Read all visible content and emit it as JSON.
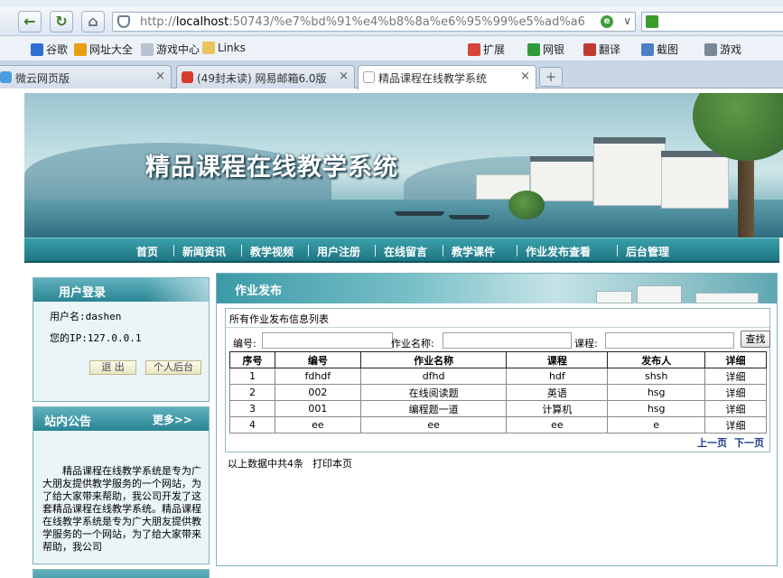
{
  "browser": {
    "url_prefix": "http://",
    "url_host": "localhost",
    "url_rest": ":50743/%e7%bd%91%e4%b8%8a%e6%95%99%e5%ad%a6",
    "bookmarks": [
      {
        "label": "谷歌",
        "icon": "google-icon",
        "color": "#2f6fd1"
      },
      {
        "label": "网址大全",
        "icon": "globe-icon",
        "color": "#e8a012"
      },
      {
        "label": "游戏中心",
        "icon": "page-icon",
        "color": "#b9c2cf"
      },
      {
        "label": "Links",
        "icon": "folder-icon",
        "color": "#e9c45a"
      },
      {
        "label": "扩展",
        "icon": "apps-icon",
        "color": "#d8453a"
      },
      {
        "label": "网银",
        "icon": "bank-icon",
        "color": "#2f9b3a"
      },
      {
        "label": "翻译",
        "icon": "translate-icon",
        "color": "#c03a2f"
      },
      {
        "label": "截图",
        "icon": "scissors-icon",
        "color": "#4c7fc6"
      },
      {
        "label": "游戏",
        "icon": "gamepad-icon",
        "color": "#7a8796"
      }
    ],
    "tabs": [
      {
        "label": "微云网页版",
        "color": "#4a9ee0"
      },
      {
        "label": "(49封未读) 网易邮箱6.0版",
        "color": "#d83a2b"
      },
      {
        "label": "精品课程在线教学系统",
        "color": "#cfd6df"
      }
    ]
  },
  "site": {
    "title": "精品课程在线教学系统",
    "nav": [
      "首页",
      "新闻资讯",
      "教学视频",
      "用户注册",
      "在线留言",
      "教学课件",
      "作业发布查看",
      "后台管理"
    ]
  },
  "login_box": {
    "heading": "用户登录",
    "username_line": "用户名:dashen",
    "ip_line": "您的IP:127.0.0.1",
    "logout_button": "退 出",
    "personal_button": "个人后台"
  },
  "notice_box": {
    "heading": "站内公告",
    "more": "更多>>",
    "text": "精品课程在线教学系统是专为广大朋友提供教学服务的一个网站，为了给大家带来帮助，我公司开发了这套精品课程在线教学系统。精品课程在线教学系统是专为广大朋友提供教学服务的一个网站，为了给大家带来帮助，我公司"
  },
  "content": {
    "heading": "作业发布",
    "list_title": "所有作业发布信息列表",
    "search": {
      "label_code": "编号:",
      "label_name": "作业名称:",
      "label_course": "课程:",
      "button": "查找",
      "value_code": "",
      "value_name": "",
      "value_course": ""
    },
    "table": {
      "headers": [
        "序号",
        "编号",
        "作业名称",
        "课程",
        "发布人",
        "详细"
      ],
      "rows": [
        [
          "1",
          "fdhdf",
          "dfhd",
          "hdf",
          "shsh",
          "详细"
        ],
        [
          "2",
          "002",
          "在线阅读题",
          "英语",
          "hsg",
          "详细"
        ],
        [
          "3",
          "001",
          "编程题一道",
          "计算机",
          "hsg",
          "详细"
        ],
        [
          "4",
          "ee",
          "ee",
          "ee",
          "e",
          "详细"
        ]
      ]
    },
    "pager": {
      "prev": "上一页",
      "next": "下一页"
    },
    "summary": "以上数据中共4条",
    "print": "打印本页"
  }
}
